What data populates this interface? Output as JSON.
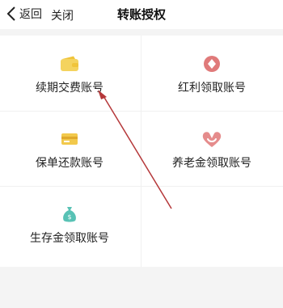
{
  "header": {
    "back_label": "返回",
    "close_label": "关闭",
    "title": "转账授权"
  },
  "accounts": [
    {
      "label": "续期交费账号",
      "icon": "wallet-icon",
      "color": "#f4d35e"
    },
    {
      "label": "红利领取账号",
      "icon": "coin-icon",
      "color": "#e07a7a"
    },
    {
      "label": "保单还款账号",
      "icon": "card-icon",
      "color": "#f2c94c"
    },
    {
      "label": "养老金领取账号",
      "icon": "heart-icon",
      "color": "#e58c8c"
    },
    {
      "label": "生存金领取账号",
      "icon": "money-bag-icon",
      "color": "#58c2b5"
    }
  ],
  "annotation": {
    "color": "#b5383a"
  }
}
